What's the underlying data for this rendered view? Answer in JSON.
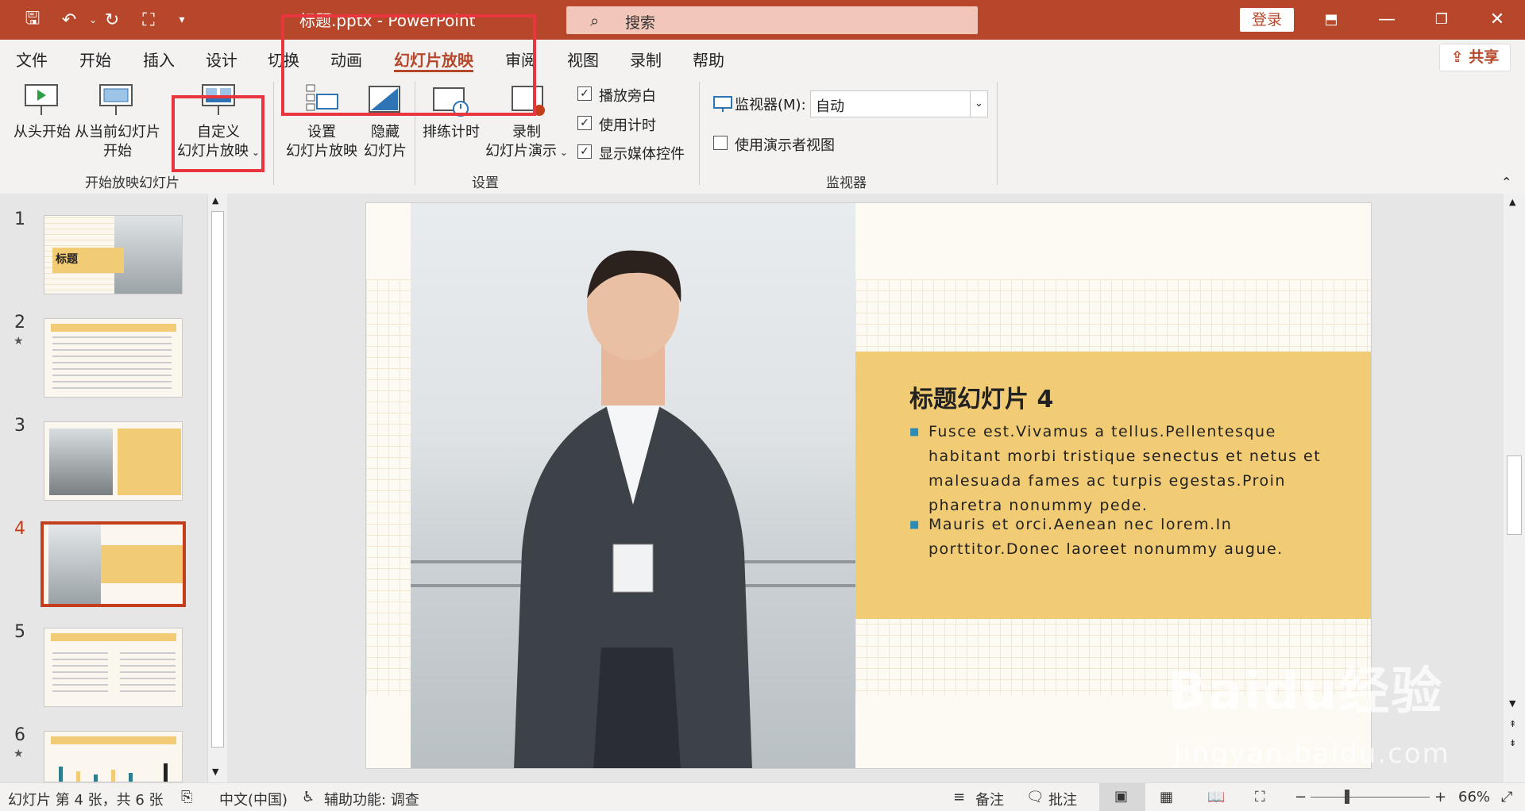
{
  "titlebar": {
    "doc_title": "标题.pptx - PowerPoint",
    "search_placeholder": "搜索",
    "login": "登录"
  },
  "menu": [
    "文件",
    "开始",
    "插入",
    "设计",
    "切换",
    "动画",
    "幻灯片放映",
    "审阅",
    "视图",
    "录制",
    "帮助"
  ],
  "share": "共享",
  "ribbon": {
    "from_beginning": "从头开始",
    "from_current_1": "从当前幻灯片",
    "from_current_2": "开始",
    "custom_1": "自定义",
    "custom_2": "幻灯片放映",
    "group_start": "开始放映幻灯片",
    "setup_1": "设置",
    "setup_2": "幻灯片放映",
    "hide_1": "隐藏",
    "hide_2": "幻灯片",
    "rehearse": "排练计时",
    "record_1": "录制",
    "record_2": "幻灯片演示",
    "play_narration": "播放旁白",
    "use_timings": "使用计时",
    "show_media": "显示媒体控件",
    "group_setup": "设置",
    "monitor_label": "监视器(M):",
    "monitor_value": "自动",
    "presenter_view": "使用演示者视图",
    "group_monitor": "监视器"
  },
  "thumbnails": [
    "1",
    "2",
    "3",
    "4",
    "5",
    "6"
  ],
  "thumb1_title": "标题",
  "slide": {
    "title": "标题幻灯片 4",
    "bullet1": "Fusce est.Vivamus a tellus.Pellentesque habitant morbi tristique senectus et netus et malesuada fames ac turpis egestas.Proin pharetra nonummy pede.",
    "bullet2": "Mauris et orci.Aenean nec lorem.In porttitor.Donec laoreet nonummy augue."
  },
  "status": {
    "slide_count": "幻灯片 第 4 张，共 6 张",
    "language": "中文(中国)",
    "accessibility": "辅助功能: 调查",
    "notes": "备注",
    "comments": "批注",
    "zoom": "66%"
  },
  "watermark": {
    "main": "Baidu经验",
    "sub": "jingyan.baidu.com"
  },
  "colors": {
    "accent": "#b7472a",
    "highlight_box": "#e8353e",
    "banner": "#f2cc74"
  }
}
